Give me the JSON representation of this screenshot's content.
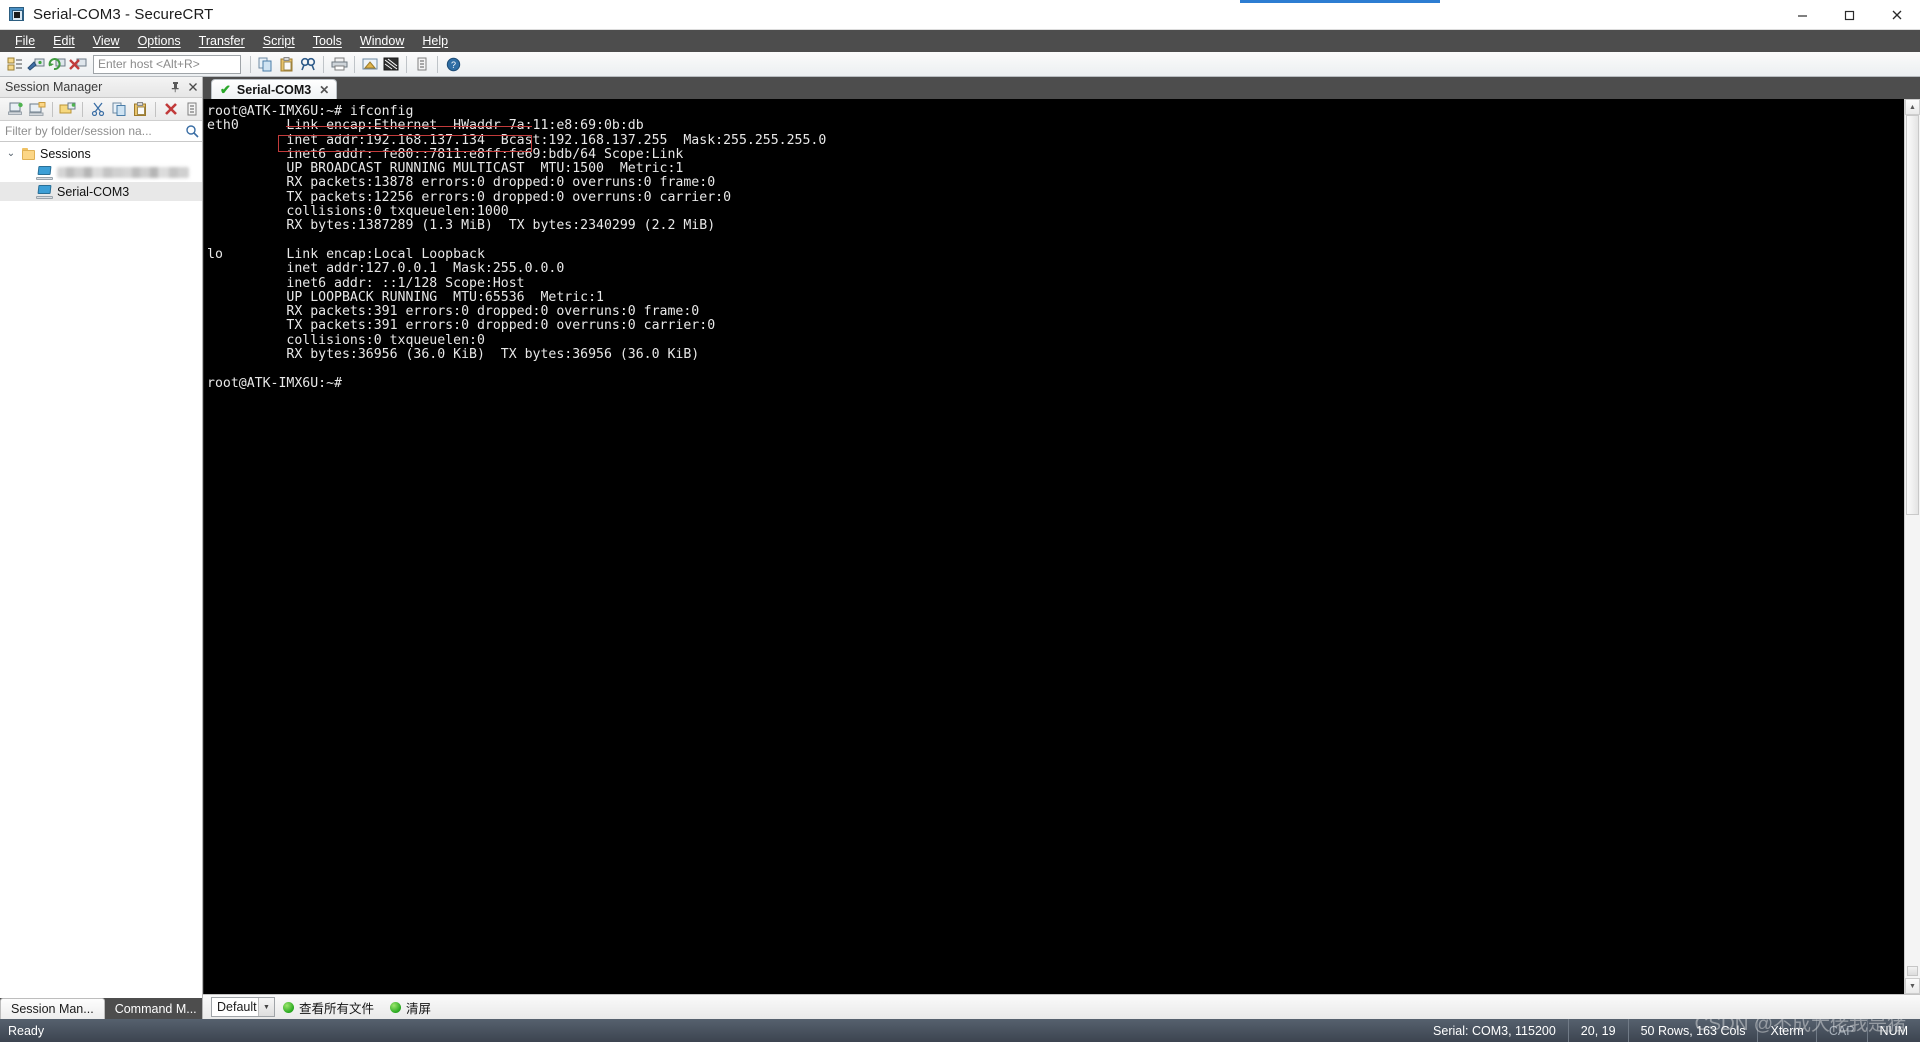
{
  "window": {
    "title": "Serial-COM3 - SecureCRT",
    "icon": "securecrt-app-icon",
    "minimize": "–",
    "maximize": "□",
    "close": "✕"
  },
  "menubar": {
    "items": [
      {
        "label": "File"
      },
      {
        "label": "Edit"
      },
      {
        "label": "View"
      },
      {
        "label": "Options"
      },
      {
        "label": "Transfer"
      },
      {
        "label": "Script"
      },
      {
        "label": "Tools"
      },
      {
        "label": "Window"
      },
      {
        "label": "Help"
      }
    ]
  },
  "toolbar": {
    "host_placeholder": "Enter host <Alt+R>",
    "icons": [
      "session-manager-icon",
      "connect-icon",
      "reconnect-icon",
      "disconnect-icon",
      "copy-icon",
      "paste-icon",
      "find-icon",
      "print-icon",
      "log-session-icon",
      "chat-window-icon",
      "properties-icon",
      "help-icon"
    ]
  },
  "session_manager": {
    "title": "Session Manager",
    "pin_icon": "pin-icon",
    "close_icon": "close-icon",
    "toolbar_icons": [
      "new-session-icon",
      "new-folder-icon",
      "connect-in-tab-icon",
      "cut-icon",
      "copy-icon",
      "paste-icon",
      "delete-icon",
      "properties-icon"
    ],
    "filter_placeholder": "Filter by folder/session na...",
    "search_icon": "search-icon",
    "tree": {
      "root": {
        "label": "Sessions",
        "expanded": true,
        "chevron": "⌄"
      },
      "items": [
        {
          "label": "",
          "redacted": true,
          "selected": false
        },
        {
          "label": "Serial-COM3",
          "redacted": false,
          "selected": true
        }
      ]
    },
    "bottom_tabs": [
      {
        "label": "Session Man...",
        "active": true
      },
      {
        "label": "Command M...",
        "active": false
      }
    ]
  },
  "terminal": {
    "tab": {
      "label": "Serial-COM3",
      "status_icon": "green-check-icon",
      "close_icon": "✕"
    },
    "lines": [
      "root@ATK-IMX6U:~# ifconfig",
      "eth0      Link encap:Ethernet  HWaddr 7a:11:e8:69:0b:db",
      "          inet addr:192.168.137.134  Bcast:192.168.137.255  Mask:255.255.255.0",
      "          inet6 addr: fe80::7811:e8ff:fe69:bdb/64 Scope:Link",
      "          UP BROADCAST RUNNING MULTICAST  MTU:1500  Metric:1",
      "          RX packets:13878 errors:0 dropped:0 overruns:0 frame:0",
      "          TX packets:12256 errors:0 dropped:0 overruns:0 carrier:0",
      "          collisions:0 txqueuelen:1000",
      "          RX bytes:1387289 (1.3 MiB)  TX bytes:2340299 (2.2 MiB)",
      "",
      "lo        Link encap:Local Loopback",
      "          inet addr:127.0.0.1  Mask:255.0.0.0",
      "          inet6 addr: ::1/128 Scope:Host",
      "          UP LOOPBACK RUNNING  MTU:65536  Metric:1",
      "          RX packets:391 errors:0 dropped:0 overruns:0 frame:0",
      "          TX packets:391 errors:0 dropped:0 overruns:0 carrier:0",
      "          collisions:0 txqueuelen:0",
      "          RX bytes:36956 (36.0 KiB)  TX bytes:36956 (36.0 KiB)",
      "",
      "root@ATK-IMX6U:~# "
    ],
    "annotation_color": "#c33b3b"
  },
  "scrollbar": {
    "up_arrow": "▲",
    "down_arrow": "▼",
    "resize_grip": "resize-grip"
  },
  "button_bar": {
    "profile": "Default",
    "dropdown_arrow": "▼",
    "buttons": [
      {
        "label": "查看所有文件",
        "dot_color": "#27a81f"
      },
      {
        "label": "清屏",
        "dot_color": "#27a81f"
      }
    ]
  },
  "statusbar": {
    "message": "Ready",
    "serial": "Serial: COM3, 115200",
    "cursor": "20, 19",
    "size": "50 Rows, 163 Cols",
    "emulation": "Xterm",
    "caps": "CAP",
    "num": "NUM"
  },
  "watermark": "CSDN @不成大佬我是猪"
}
